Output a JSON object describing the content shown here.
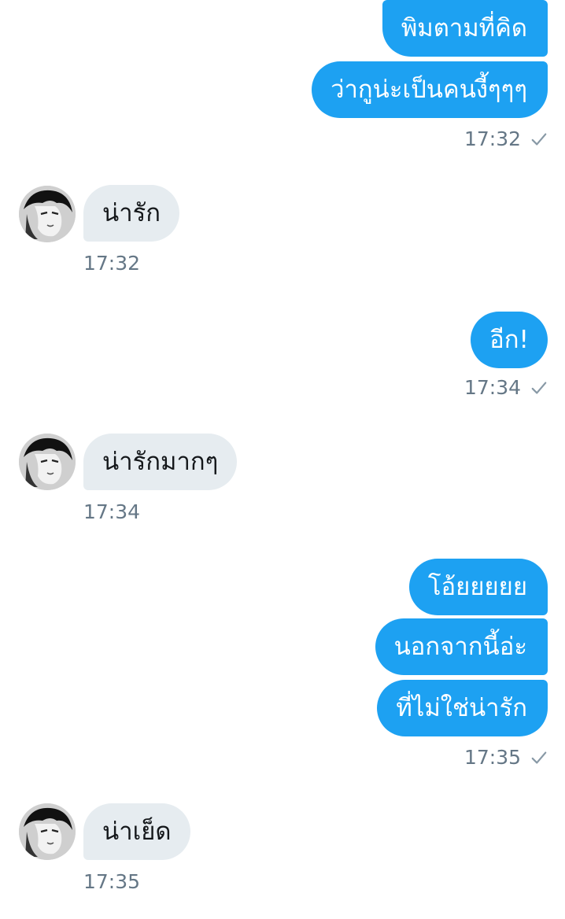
{
  "conversation": {
    "group1": {
      "msg1": "พิมตามที่คิด",
      "msg2": "ว่ากูน่ะเป็นคนงี้ๆๆๆ",
      "time": "17:32"
    },
    "reply1": {
      "msg": "น่ารัก",
      "time": "17:32"
    },
    "group2": {
      "msg1": "อีก!",
      "time": "17:34"
    },
    "reply2": {
      "msg": "น่ารักมากๆ",
      "time": "17:34"
    },
    "group3": {
      "msg1": "โอ้ยยยยย",
      "msg2": "นอกจากนี้อ่ะ",
      "msg3": "ที่ไม่ใช่น่ารัก",
      "time": "17:35"
    },
    "reply3": {
      "msg": "น่าเย็ด",
      "time": "17:35"
    }
  },
  "colors": {
    "outgoing_bubble": "#1da1f2",
    "incoming_bubble": "#e6ecf0",
    "timestamp": "#657786"
  },
  "icons": {
    "read_receipt": "check-icon",
    "avatar": "user-avatar"
  }
}
